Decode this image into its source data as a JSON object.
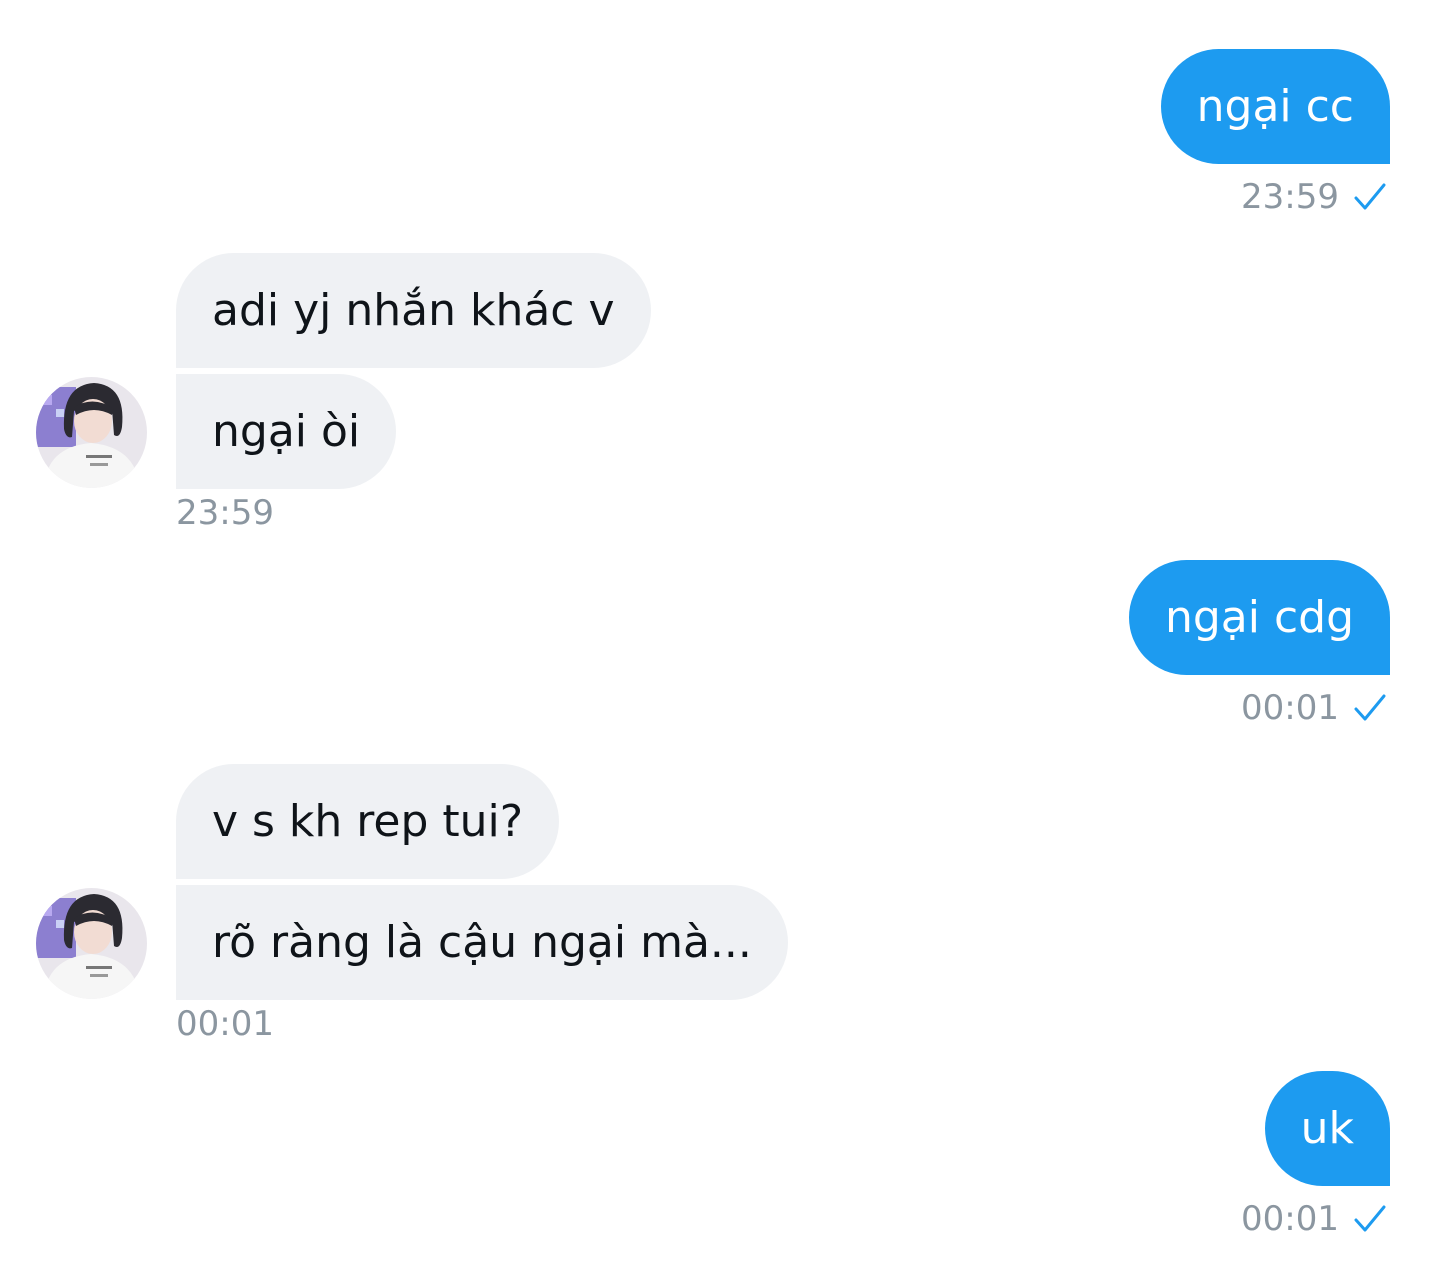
{
  "messages": [
    {
      "direction": "out",
      "text": "ngại cc",
      "time": "23:59",
      "status_icon": "sent-check-icon"
    },
    {
      "direction": "in",
      "text": "adi yj nhắn khác v"
    },
    {
      "direction": "in",
      "text": "ngại òi",
      "time": "23:59"
    },
    {
      "direction": "out",
      "text": "ngại cdg",
      "time": "00:01",
      "status_icon": "sent-check-icon"
    },
    {
      "direction": "in",
      "text": "v s kh rep tui?"
    },
    {
      "direction": "in",
      "text": "rõ ràng là cậu ngại mà...",
      "time": "00:01"
    },
    {
      "direction": "out",
      "text": "uk",
      "time": "00:01",
      "status_icon": "sent-check-icon"
    }
  ],
  "colors": {
    "outgoing_bubble": "#1d9bf0",
    "incoming_bubble": "#eff1f4",
    "timestamp": "#8b96a0",
    "check": "#1d9bf0"
  }
}
